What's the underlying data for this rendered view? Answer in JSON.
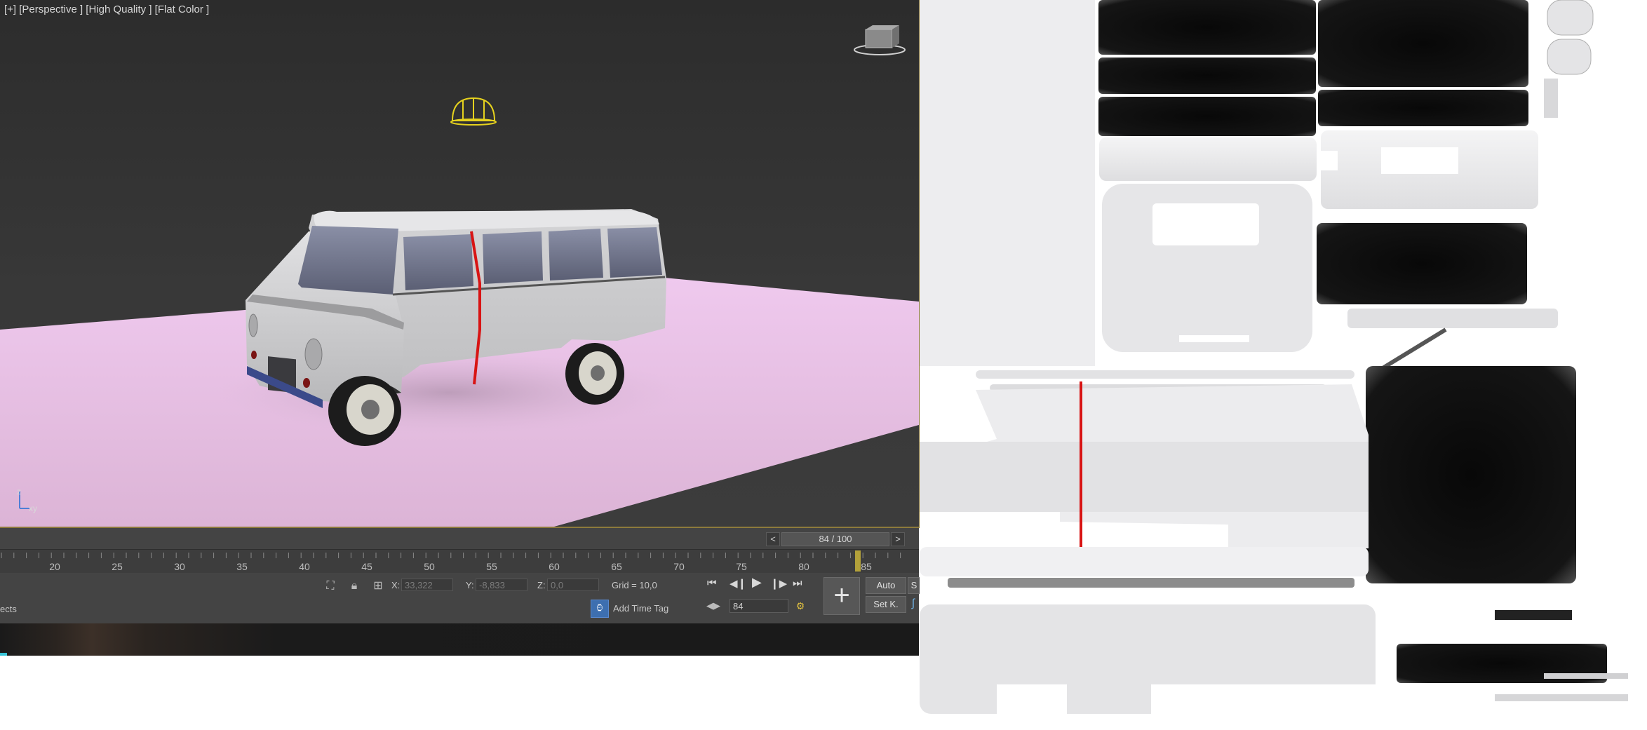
{
  "viewport": {
    "label": "[+] [Perspective ] [High Quality ] [Flat Color ]",
    "axis": {
      "z": "z",
      "xy": "xy"
    }
  },
  "frame": {
    "prev": "<",
    "next": ">",
    "display": "84 / 100"
  },
  "timeline": {
    "ticks": [
      "20",
      "25",
      "30",
      "35",
      "40",
      "45",
      "50",
      "55",
      "60",
      "65",
      "70",
      "75",
      "80",
      "85"
    ]
  },
  "status": {
    "left_text": "ects",
    "x_label": "X:",
    "x_value": "33,322",
    "y_label": "Y:",
    "y_value": "-8,833",
    "z_label": "Z:",
    "z_value": "0,0",
    "grid": "Grid = 10,0",
    "add_time_tag": "Add Time Tag",
    "current_frame": "84",
    "auto_label": "Auto",
    "setkey_label": "Set K.",
    "cut_label": "S"
  },
  "icons": {
    "viewcube": "viewcube-icon",
    "light": "skylight-icon",
    "go_start": "go-to-start-icon",
    "prev_frame": "previous-frame-icon",
    "play": "play-icon",
    "next_frame": "next-frame-icon",
    "go_end": "go-to-end-icon",
    "set_key": "set-key-icon",
    "key_filters": "key-filters-icon",
    "time_config": "time-configuration-icon"
  },
  "colors": {
    "ground": "#e8c3e4",
    "car_body": "#c9c9cb",
    "seam": "#d81414",
    "viewport_border": "#8d7a3c",
    "light_icon": "#e6d21e"
  }
}
